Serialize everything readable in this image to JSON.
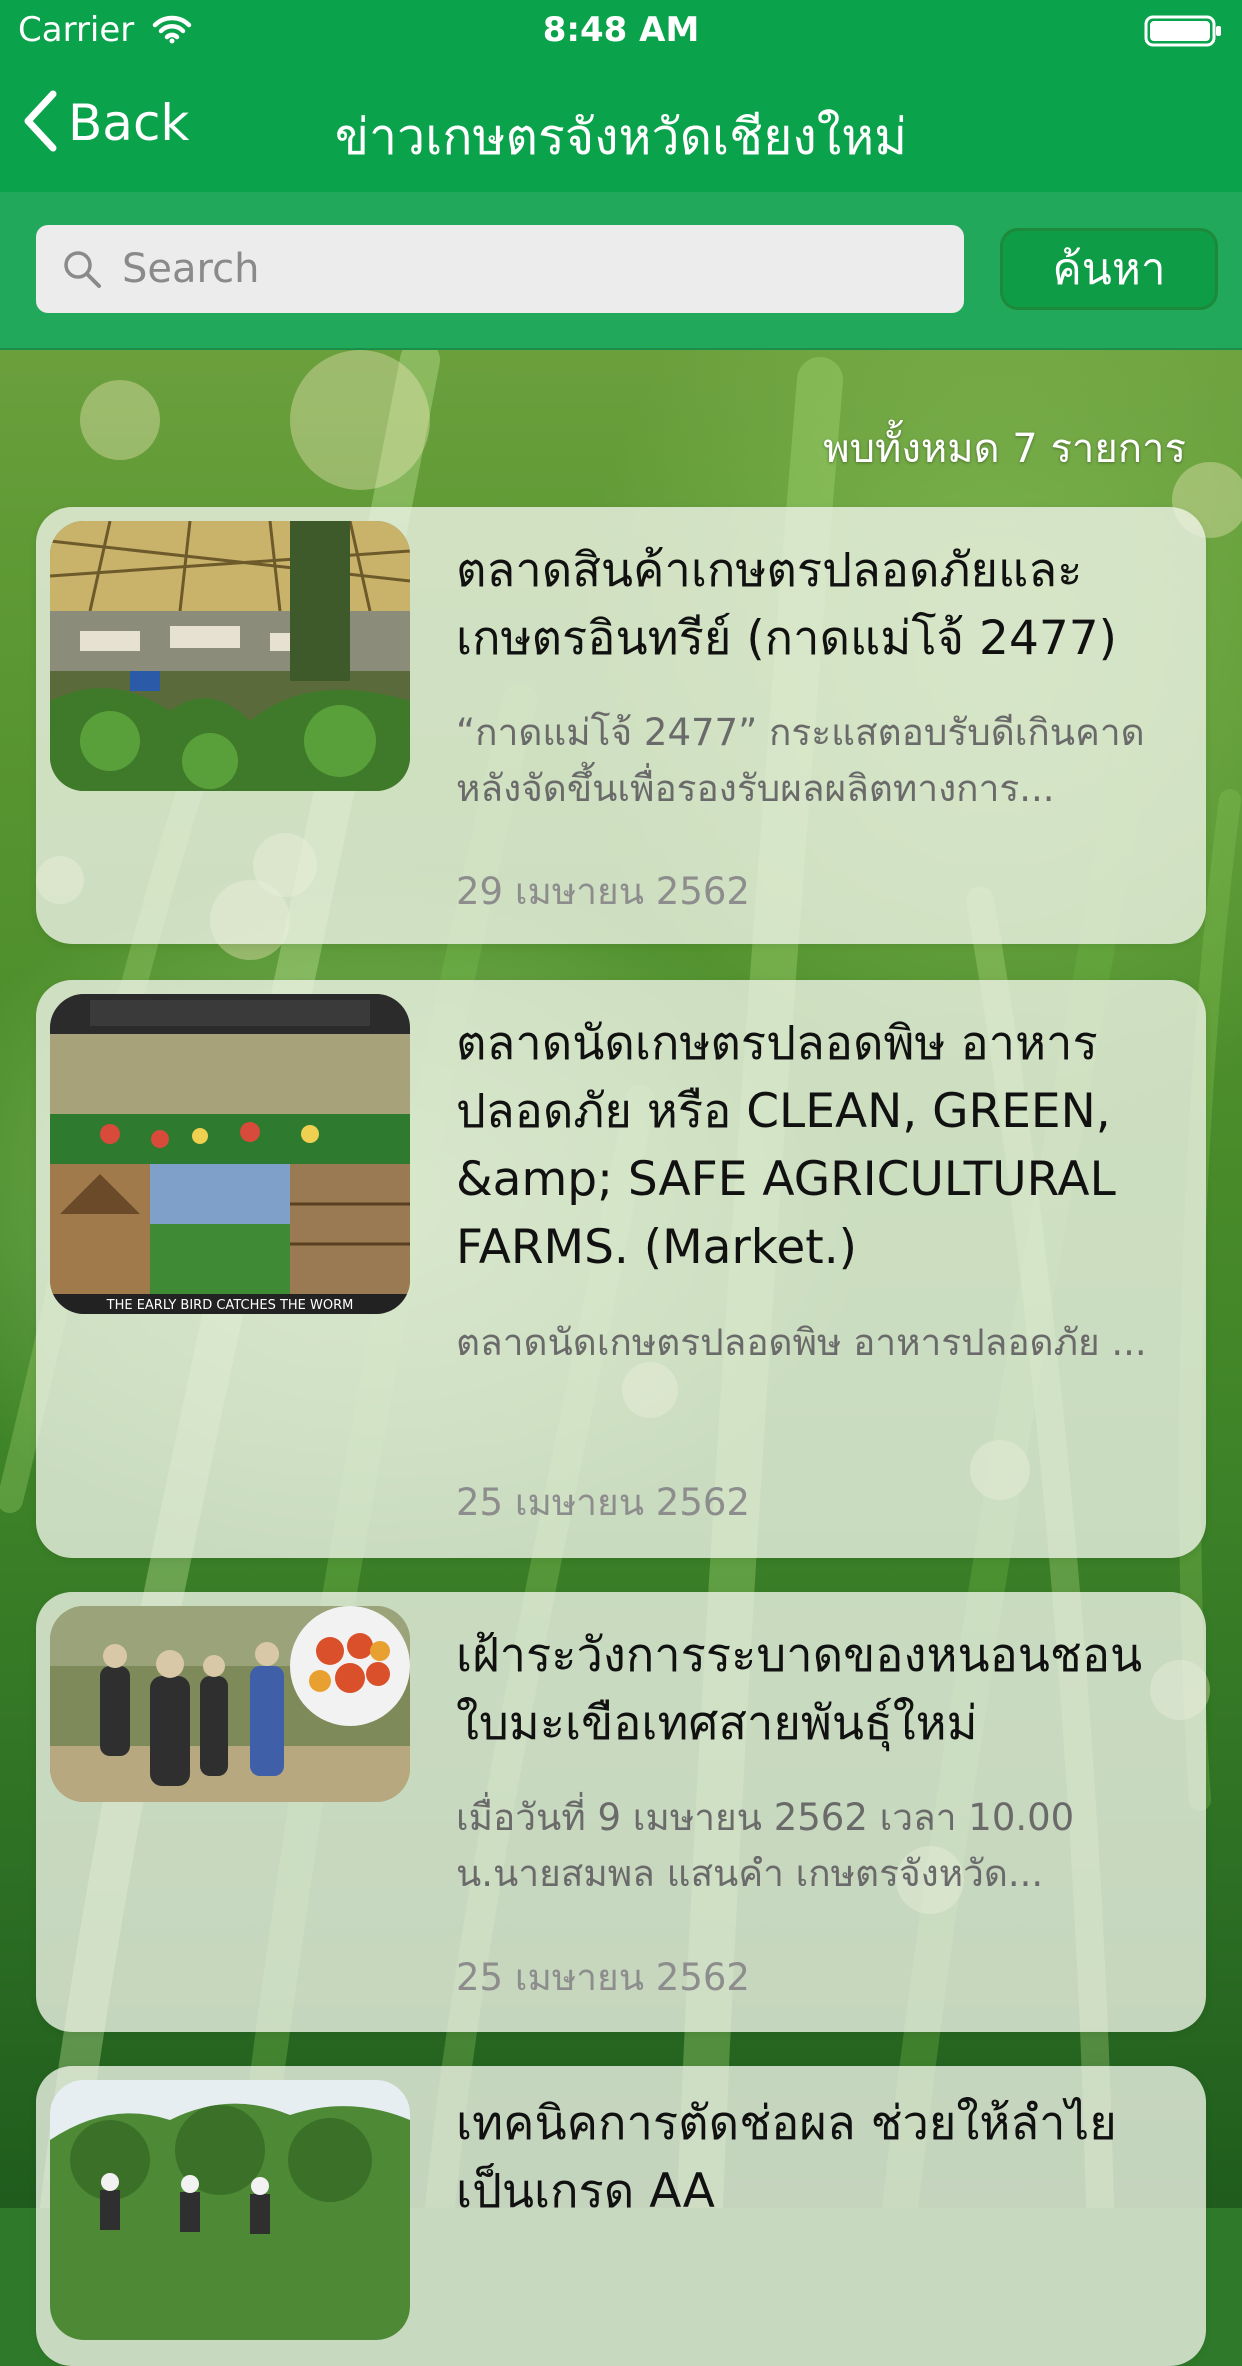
{
  "status_bar": {
    "carrier": "Carrier",
    "time": "8:48 AM"
  },
  "nav": {
    "back_label": "Back",
    "title": "ข่าวเกษตรจังหวัดเชียงใหม่"
  },
  "search": {
    "placeholder": "Search",
    "value": "",
    "button_label": "ค้นหา"
  },
  "result_count": "พบทั้งหมด 7 รายการ",
  "news": [
    {
      "title": "ตลาดสินค้าเกษตรปลอดภัยและเกษตรอินทรีย์ (กาดแม่โจ้ 2477)",
      "description": "“กาดแม่โจ้ 2477” กระแสตอบรับดีเกินคาด หลังจัดขึ้นเพื่อรองรับผลผลิตทางการ...",
      "date": "29 เมษายน 2562"
    },
    {
      "title": "ตลาดนัดเกษตรปลอดพิษ อาหารปลอดภัย หรือ CLEAN, GREEN, &amp; SAFE AGRICULTURAL FARMS. (Market.)",
      "description": "ตลาดนัดเกษตรปลอดพิษ อาหารปลอดภัย ...",
      "date": "25 เมษายน 2562",
      "image_caption": "THE EARLY BIRD CATCHES THE WORM"
    },
    {
      "title": "เฝ้าระวังการระบาดของหนอนชอนใบมะเขือเทศสายพันธุ์ใหม่",
      "description": "เมื่อวันที่ 9 เมษายน 2562 เวลา 10.00 น.นายสมพล แสนคำ เกษตรจังหวัด...",
      "date": "25 เมษายน 2562"
    },
    {
      "title": "เทคนิคการตัดช่อผล ช่วยให้ลำไยเป็นเกรด AA",
      "description": "",
      "date": ""
    }
  ],
  "colors": {
    "header_green": "#0aa24b",
    "search_bar_green": "#22a85a",
    "button_green": "#0f9c46"
  }
}
